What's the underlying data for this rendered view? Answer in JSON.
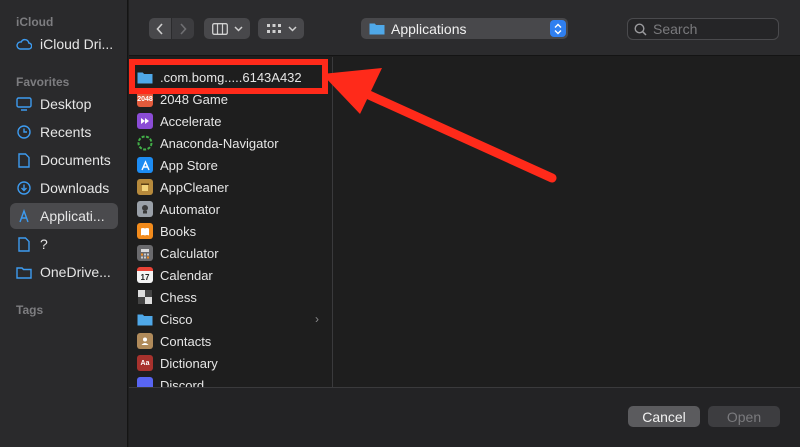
{
  "sidebar": {
    "icloud_heading": "iCloud",
    "favorites_heading": "Favorites",
    "tags_heading": "Tags",
    "items": [
      {
        "label": "iCloud Dri..."
      },
      {
        "label": "Desktop"
      },
      {
        "label": "Recents"
      },
      {
        "label": "Documents"
      },
      {
        "label": "Downloads"
      },
      {
        "label": "Applicati..."
      },
      {
        "label": "?"
      },
      {
        "label": "OneDrive..."
      }
    ]
  },
  "toolbar": {
    "location": "Applications",
    "search_placeholder": "Search"
  },
  "files": [
    {
      "name": ".com.bomg.....6143A432",
      "icon": "folder-icon"
    },
    {
      "name": "2048 Game",
      "icon": "game-2048-icon",
      "badge": "2048"
    },
    {
      "name": "Accelerate",
      "icon": "accelerate-icon"
    },
    {
      "name": "Anaconda-Navigator",
      "icon": "anaconda-icon"
    },
    {
      "name": "App Store",
      "icon": "app-store-icon"
    },
    {
      "name": "AppCleaner",
      "icon": "appcleaner-icon"
    },
    {
      "name": "Automator",
      "icon": "automator-icon"
    },
    {
      "name": "Books",
      "icon": "books-icon"
    },
    {
      "name": "Calculator",
      "icon": "calculator-icon"
    },
    {
      "name": "Calendar",
      "icon": "calendar-icon",
      "badge": "17"
    },
    {
      "name": "Chess",
      "icon": "chess-icon"
    },
    {
      "name": "Cisco",
      "icon": "folder-icon"
    },
    {
      "name": "Contacts",
      "icon": "contacts-icon"
    },
    {
      "name": "Dictionary",
      "icon": "dictionary-icon",
      "badge": "Aa"
    },
    {
      "name": "Discord",
      "icon": "discord-icon"
    }
  ],
  "footer": {
    "cancel_label": "Cancel",
    "open_label": "Open"
  },
  "colors": {
    "accent": "#2f7ff0",
    "annotation": "#ff2a1a",
    "folder": "#4fa8e8"
  }
}
